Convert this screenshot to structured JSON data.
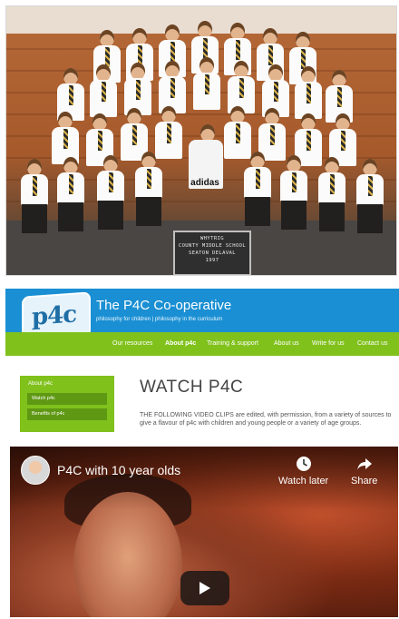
{
  "photo": {
    "shirt_text": "adidas",
    "sign": {
      "line1": "WHYTRIG",
      "line2": "COUNTY MIDDLE SCHOOL",
      "line3": "SEATON DELAVAL",
      "line4": "1997"
    }
  },
  "site": {
    "title": "The P4C Co-operative",
    "tagline": "philosophy for children | philosophy in the curriculum",
    "logo_text": "p4c",
    "nav": [
      {
        "label": "Our resources"
      },
      {
        "label": "About p4c"
      },
      {
        "label": "Training & support"
      },
      {
        "label": "About us"
      },
      {
        "label": "Write for us"
      },
      {
        "label": "Contact us"
      }
    ],
    "sidebar": {
      "title": "About p4c",
      "items": [
        {
          "label": "Watch p4c"
        },
        {
          "label": "Benefits of p4c"
        }
      ]
    },
    "page_title": "WATCH P4C",
    "intro": "THE FOLLOWING VIDEO CLIPS are edited, with permission, from a variety of sources to give a flavour of p4c with children and young people or a variety of age groups."
  },
  "video": {
    "title": "P4C with 10 year olds",
    "watch_later": "Watch later",
    "share": "Share"
  },
  "colors": {
    "header_blue": "#1a8fd3",
    "nav_green": "#80c11c",
    "sidebar_dark_green": "#5f9813"
  }
}
